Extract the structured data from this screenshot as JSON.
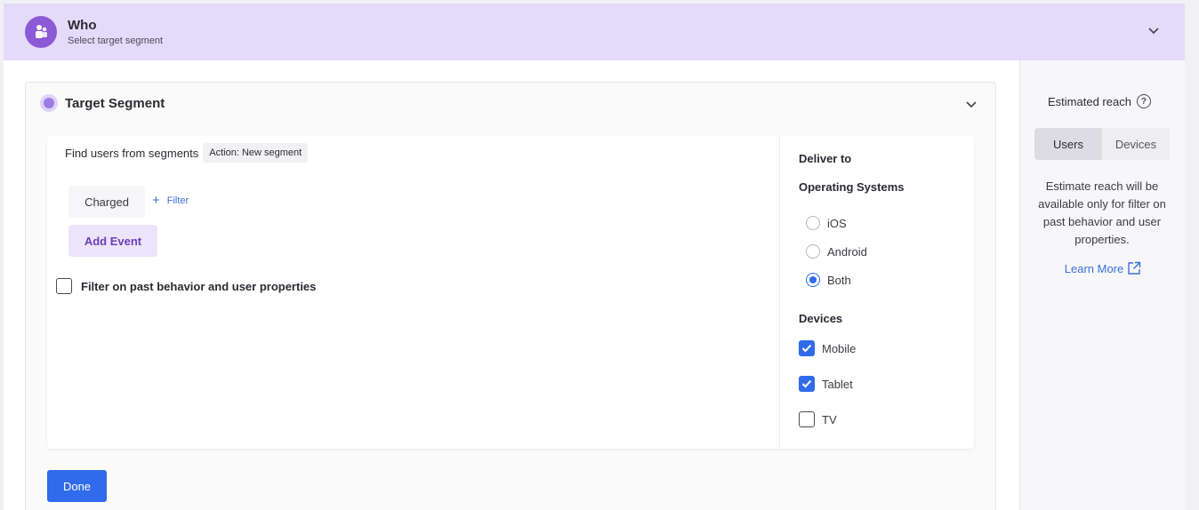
{
  "who": {
    "title": "Who",
    "subtitle": "Select target segment"
  },
  "target_segment": {
    "title": "Target Segment",
    "find_label": "Find users from segments",
    "action_tag": "Action: New segment",
    "event_chip": "Charged",
    "filter_link": "Filter",
    "add_event": "Add Event",
    "past_behavior_label": "Filter on past behavior and user properties",
    "past_behavior_checked": false
  },
  "deliver": {
    "title": "Deliver to",
    "os_title": "Operating Systems",
    "os_options": [
      {
        "label": "iOS",
        "selected": false
      },
      {
        "label": "Android",
        "selected": false
      },
      {
        "label": "Both",
        "selected": true
      }
    ],
    "devices_title": "Devices",
    "devices": [
      {
        "label": "Mobile",
        "checked": true
      },
      {
        "label": "Tablet",
        "checked": true
      },
      {
        "label": "TV",
        "checked": false
      }
    ]
  },
  "done_label": "Done",
  "reach": {
    "title": "Estimated reach",
    "tabs": [
      "Users",
      "Devices"
    ],
    "active_tab": "Users",
    "note": "Estimate reach will be available only for filter on past behavior and user properties.",
    "learn_more": "Learn More"
  },
  "colors": {
    "accent_blue": "#2f6bea",
    "header_purple": "#e4dafa",
    "avatar_purple": "#8c5ad6"
  }
}
